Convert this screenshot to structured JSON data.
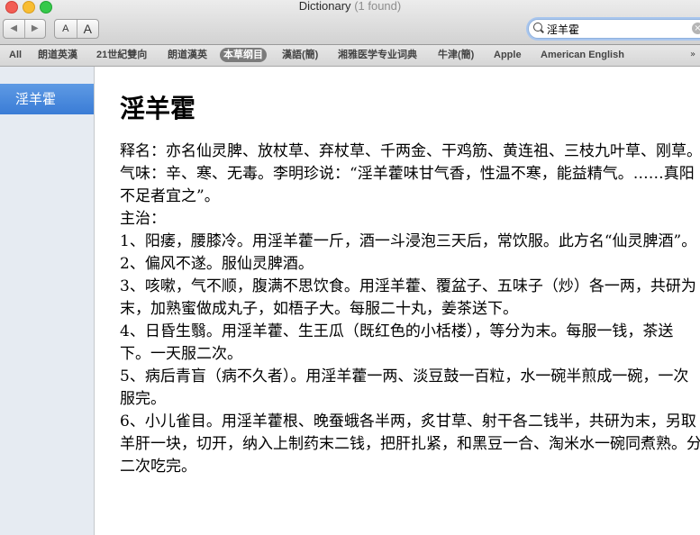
{
  "window": {
    "title": "Dictionary",
    "count": "(1 found)"
  },
  "toolbar": {
    "back_label": "◀",
    "forward_label": "▶",
    "font_small_label": "A",
    "font_large_label": "A"
  },
  "search": {
    "value": "淫羊霍",
    "clear_label": "×"
  },
  "scopes": [
    "All",
    "朗道英漢",
    "21世紀雙向",
    "朗道漢英",
    "本草纲目",
    "漢語(簡)",
    "湘雅医学专业词典",
    "牛津(簡)",
    "Apple",
    "American English"
  ],
  "scope_selected": "本草纲目",
  "sidebar": {
    "items": [
      "淫羊霍"
    ]
  },
  "entry": {
    "headword": "淫羊霍",
    "lines": [
      "释名：亦名仙灵脾、放杖草、弃杖草、千两金、干鸡筋、黄连祖、三枝九叶草、刚草。",
      "气味：辛、寒、无毒。李明珍说：“淫羊藿味甘气香，性温不寒，能益精气。……真阳不足者宜之”。",
      "主治：",
      "1、阳痿，腰膝冷。用淫羊藿一斤，酒一斗浸泡三天后，常饮服。此方名“仙灵脾酒”。",
      "2、偏风不遂。服仙灵脾酒。",
      "3、咳嗽，气不顺，腹满不思饮食。用淫羊藿、覆盆子、五味子（炒）各一两，共研为末，加熟蜜做成丸子，如梧子大。每服二十丸，姜茶送下。",
      "4、日昏生翳。用淫羊藿、生王瓜（既红色的小栝楼），等分为末。每服一钱，茶送下。一天服二次。",
      "5、病后青盲（病不久者）。用淫羊藿一两、淡豆鼓一百粒，水一碗半煎成一碗，一次服完。",
      "6、小儿雀目。用淫羊藿根、晚蚕蛾各半两，炙甘草、射干各二钱半，共研为末，另取羊肝一块，切开，纳入上制药末二钱，把肝扎紧，和黑豆一合、淘米水一碗同煮熟。分二次吃完。"
    ]
  },
  "colors": {
    "selection": "#3a7cd6",
    "scope_selected_bg": "#7b7b7b",
    "sidebar_bg": "#e6ebf2"
  },
  "icons": [
    "close-window-icon",
    "minimize-window-icon",
    "zoom-window-icon",
    "search-icon",
    "clear-search-icon",
    "scope-overflow-icon"
  ]
}
